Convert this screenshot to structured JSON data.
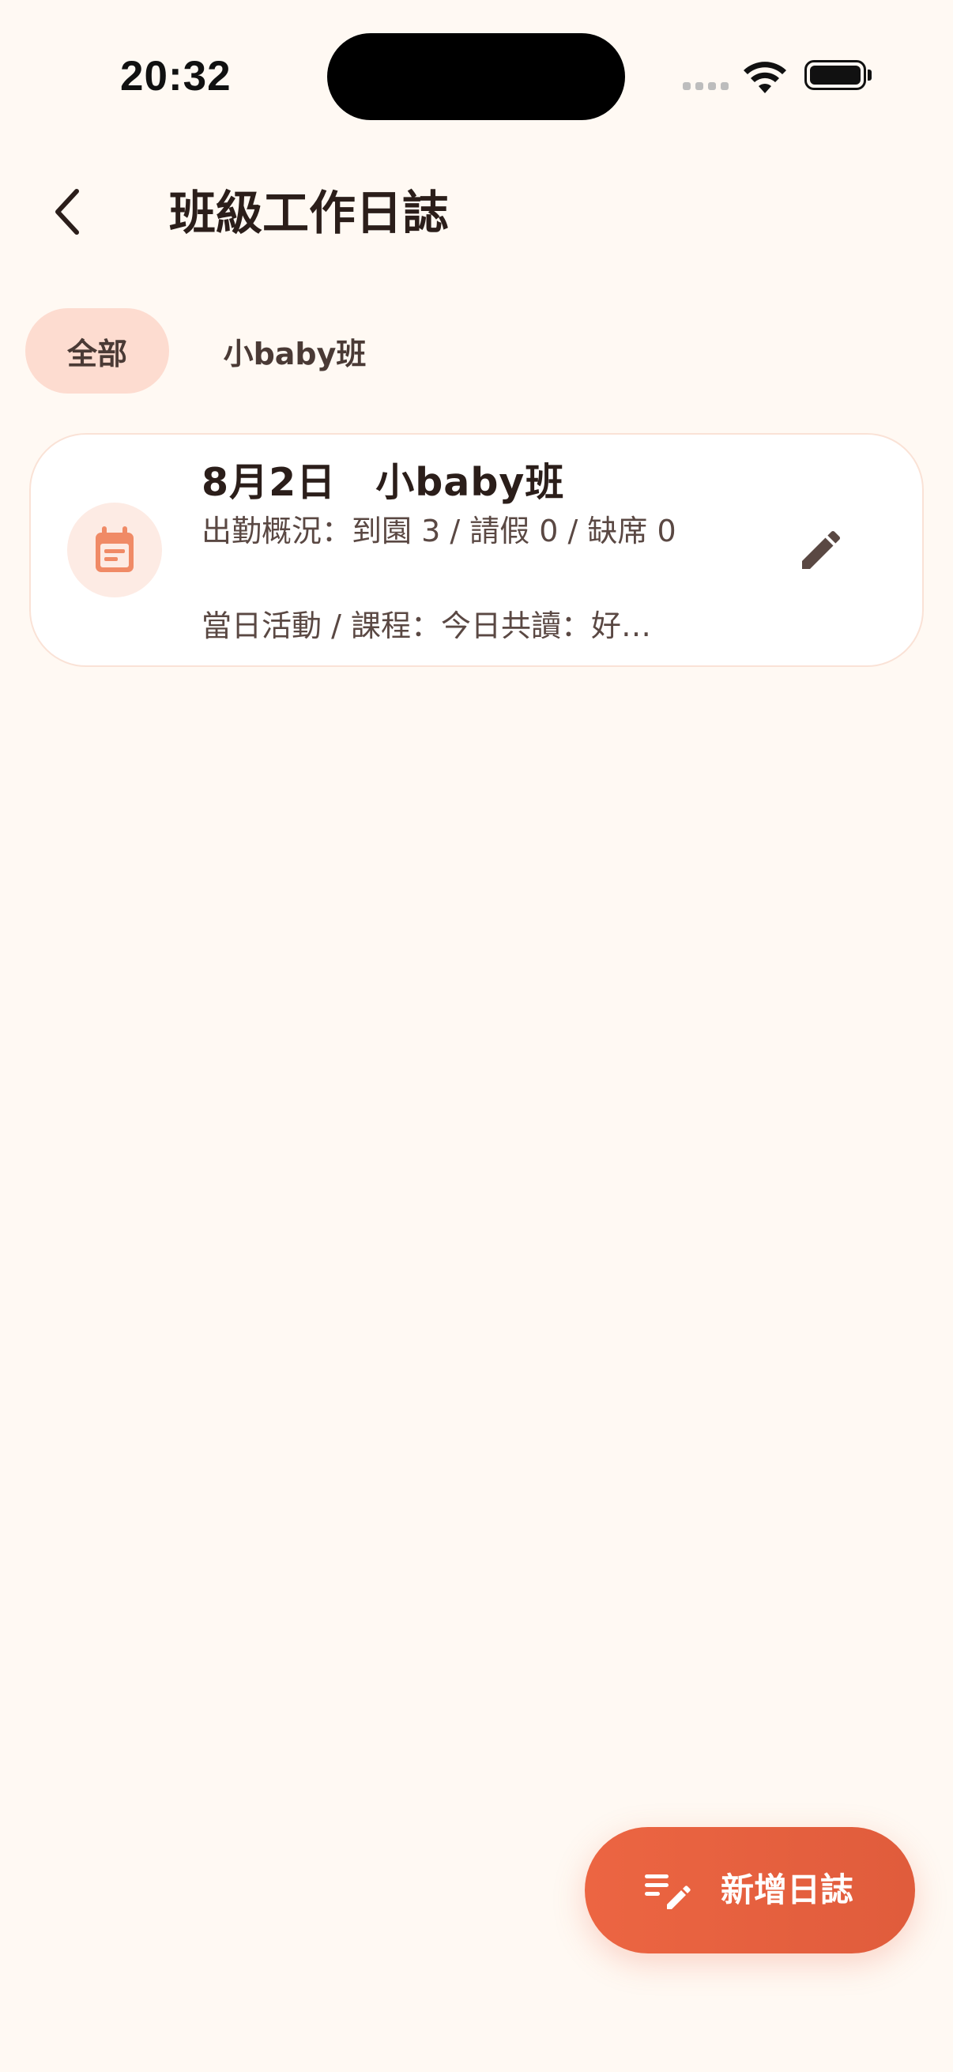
{
  "status_bar": {
    "time": "20:32"
  },
  "header": {
    "title": "班級工作日誌",
    "back_icon": "chevron-left-icon"
  },
  "tabs": [
    {
      "label": "全部",
      "selected": true
    },
    {
      "label": "小baby班",
      "selected": false
    }
  ],
  "logs": [
    {
      "title": "8月2日　小baby班",
      "attendance": "出勤概況：到園 3 / 請假 0 / 缺席 0",
      "activity": "當日活動 / 課程：今日共讀：好…",
      "icon": "calendar-icon",
      "edit_icon": "pencil-icon"
    }
  ],
  "fab": {
    "label": "新增日誌",
    "icon": "edit-note-icon"
  },
  "colors": {
    "background": "#FFF9F3",
    "accent": "#EC6542",
    "tab_selected_bg": "#FDDCD0",
    "icon_circle_bg": "#FDEBE4",
    "icon_color": "#F08A66",
    "text_primary": "#2B1E1A",
    "text_secondary": "#5A4843"
  }
}
